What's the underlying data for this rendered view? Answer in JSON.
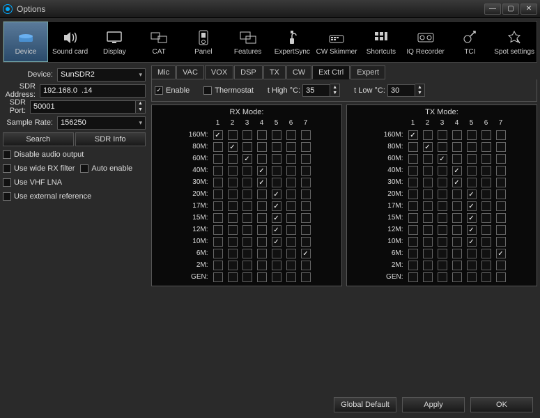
{
  "window": {
    "title": "Options"
  },
  "toolbar": [
    {
      "id": "device",
      "label": "Device",
      "selected": true
    },
    {
      "id": "soundcard",
      "label": "Sound card"
    },
    {
      "id": "display",
      "label": "Display"
    },
    {
      "id": "cat",
      "label": "CAT"
    },
    {
      "id": "panel",
      "label": "Panel"
    },
    {
      "id": "features",
      "label": "Features"
    },
    {
      "id": "expertsync",
      "label": "ExpertSync"
    },
    {
      "id": "cwskimmer",
      "label": "CW Skimmer"
    },
    {
      "id": "shortcuts",
      "label": "Shortcuts"
    },
    {
      "id": "iqrecorder",
      "label": "IQ Recorder"
    },
    {
      "id": "tci",
      "label": "TCI"
    },
    {
      "id": "spotsettings",
      "label": "Spot settings"
    }
  ],
  "left": {
    "device_label": "Device:",
    "device_value": "SunSDR2",
    "addr_label": "SDR Address:",
    "addr_value": "192.168.0  .14",
    "port_label": "SDR Port:",
    "port_value": "50001",
    "rate_label": "Sample Rate:",
    "rate_value": "156250",
    "search": "Search",
    "info": "SDR Info",
    "chk_disable": "Disable audio output",
    "chk_widerx": "Use wide RX filter",
    "chk_autoen": "Auto enable",
    "chk_vhflna": "Use VHF LNA",
    "chk_extref": "Use external reference"
  },
  "tabs": [
    "Mic",
    "VAC",
    "VOX",
    "DSP",
    "TX",
    "CW",
    "Ext Ctrl",
    "Expert"
  ],
  "tab_active": 6,
  "extctrl": {
    "enable_label": "Enable",
    "enable": true,
    "thermo_label": "Thermostat",
    "thermo": false,
    "thigh_label": "t High °C:",
    "thigh": "35",
    "tlow_label": "t Low °C:",
    "tlow": "30"
  },
  "mode_cols": [
    "1",
    "2",
    "3",
    "4",
    "5",
    "6",
    "7"
  ],
  "bands": [
    "160M:",
    "80M:",
    "60M:",
    "40M:",
    "30M:",
    "20M:",
    "17M:",
    "15M:",
    "12M:",
    "10M:",
    "6M:",
    "2M:",
    "GEN:"
  ],
  "rx_title": "RX Mode:",
  "tx_title": "TX Mode:",
  "rx_data": [
    [
      1,
      0,
      0,
      0,
      0,
      0,
      0
    ],
    [
      0,
      1,
      0,
      0,
      0,
      0,
      0
    ],
    [
      0,
      0,
      1,
      0,
      0,
      0,
      0
    ],
    [
      0,
      0,
      0,
      1,
      0,
      0,
      0
    ],
    [
      0,
      0,
      0,
      1,
      0,
      0,
      0
    ],
    [
      0,
      0,
      0,
      0,
      1,
      0,
      0
    ],
    [
      0,
      0,
      0,
      0,
      1,
      0,
      0
    ],
    [
      0,
      0,
      0,
      0,
      1,
      0,
      0
    ],
    [
      0,
      0,
      0,
      0,
      1,
      0,
      0
    ],
    [
      0,
      0,
      0,
      0,
      1,
      0,
      0
    ],
    [
      0,
      0,
      0,
      0,
      0,
      0,
      1
    ],
    [
      0,
      0,
      0,
      0,
      0,
      0,
      0
    ],
    [
      0,
      0,
      0,
      0,
      0,
      0,
      0
    ]
  ],
  "tx_data": [
    [
      1,
      0,
      0,
      0,
      0,
      0,
      0
    ],
    [
      0,
      1,
      0,
      0,
      0,
      0,
      0
    ],
    [
      0,
      0,
      1,
      0,
      0,
      0,
      0
    ],
    [
      0,
      0,
      0,
      1,
      0,
      0,
      0
    ],
    [
      0,
      0,
      0,
      1,
      0,
      0,
      0
    ],
    [
      0,
      0,
      0,
      0,
      1,
      0,
      0
    ],
    [
      0,
      0,
      0,
      0,
      1,
      0,
      0
    ],
    [
      0,
      0,
      0,
      0,
      1,
      0,
      0
    ],
    [
      0,
      0,
      0,
      0,
      1,
      0,
      0
    ],
    [
      0,
      0,
      0,
      0,
      1,
      0,
      0
    ],
    [
      0,
      0,
      0,
      0,
      0,
      0,
      1
    ],
    [
      0,
      0,
      0,
      0,
      0,
      0,
      0
    ],
    [
      0,
      0,
      0,
      0,
      0,
      0,
      0
    ]
  ],
  "footer": {
    "global": "Global Default",
    "apply": "Apply",
    "ok": "OK"
  }
}
